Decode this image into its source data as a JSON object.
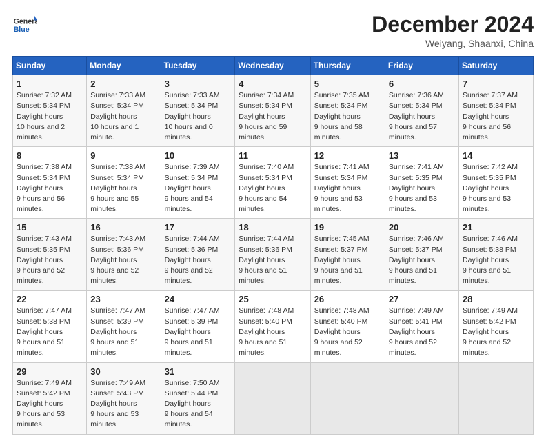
{
  "header": {
    "logo": {
      "general": "General",
      "blue": "Blue"
    },
    "title": "December 2024",
    "subtitle": "Weiyang, Shaanxi, China"
  },
  "weekdays": [
    "Sunday",
    "Monday",
    "Tuesday",
    "Wednesday",
    "Thursday",
    "Friday",
    "Saturday"
  ],
  "weeks": [
    [
      {
        "day": "1",
        "sunrise": "7:32 AM",
        "sunset": "5:34 PM",
        "daylight": "10 hours and 2 minutes."
      },
      {
        "day": "2",
        "sunrise": "7:33 AM",
        "sunset": "5:34 PM",
        "daylight": "10 hours and 1 minute."
      },
      {
        "day": "3",
        "sunrise": "7:33 AM",
        "sunset": "5:34 PM",
        "daylight": "10 hours and 0 minutes."
      },
      {
        "day": "4",
        "sunrise": "7:34 AM",
        "sunset": "5:34 PM",
        "daylight": "9 hours and 59 minutes."
      },
      {
        "day": "5",
        "sunrise": "7:35 AM",
        "sunset": "5:34 PM",
        "daylight": "9 hours and 58 minutes."
      },
      {
        "day": "6",
        "sunrise": "7:36 AM",
        "sunset": "5:34 PM",
        "daylight": "9 hours and 57 minutes."
      },
      {
        "day": "7",
        "sunrise": "7:37 AM",
        "sunset": "5:34 PM",
        "daylight": "9 hours and 56 minutes."
      }
    ],
    [
      {
        "day": "8",
        "sunrise": "7:38 AM",
        "sunset": "5:34 PM",
        "daylight": "9 hours and 56 minutes."
      },
      {
        "day": "9",
        "sunrise": "7:38 AM",
        "sunset": "5:34 PM",
        "daylight": "9 hours and 55 minutes."
      },
      {
        "day": "10",
        "sunrise": "7:39 AM",
        "sunset": "5:34 PM",
        "daylight": "9 hours and 54 minutes."
      },
      {
        "day": "11",
        "sunrise": "7:40 AM",
        "sunset": "5:34 PM",
        "daylight": "9 hours and 54 minutes."
      },
      {
        "day": "12",
        "sunrise": "7:41 AM",
        "sunset": "5:34 PM",
        "daylight": "9 hours and 53 minutes."
      },
      {
        "day": "13",
        "sunrise": "7:41 AM",
        "sunset": "5:35 PM",
        "daylight": "9 hours and 53 minutes."
      },
      {
        "day": "14",
        "sunrise": "7:42 AM",
        "sunset": "5:35 PM",
        "daylight": "9 hours and 53 minutes."
      }
    ],
    [
      {
        "day": "15",
        "sunrise": "7:43 AM",
        "sunset": "5:35 PM",
        "daylight": "9 hours and 52 minutes."
      },
      {
        "day": "16",
        "sunrise": "7:43 AM",
        "sunset": "5:36 PM",
        "daylight": "9 hours and 52 minutes."
      },
      {
        "day": "17",
        "sunrise": "7:44 AM",
        "sunset": "5:36 PM",
        "daylight": "9 hours and 52 minutes."
      },
      {
        "day": "18",
        "sunrise": "7:44 AM",
        "sunset": "5:36 PM",
        "daylight": "9 hours and 51 minutes."
      },
      {
        "day": "19",
        "sunrise": "7:45 AM",
        "sunset": "5:37 PM",
        "daylight": "9 hours and 51 minutes."
      },
      {
        "day": "20",
        "sunrise": "7:46 AM",
        "sunset": "5:37 PM",
        "daylight": "9 hours and 51 minutes."
      },
      {
        "day": "21",
        "sunrise": "7:46 AM",
        "sunset": "5:38 PM",
        "daylight": "9 hours and 51 minutes."
      }
    ],
    [
      {
        "day": "22",
        "sunrise": "7:47 AM",
        "sunset": "5:38 PM",
        "daylight": "9 hours and 51 minutes."
      },
      {
        "day": "23",
        "sunrise": "7:47 AM",
        "sunset": "5:39 PM",
        "daylight": "9 hours and 51 minutes."
      },
      {
        "day": "24",
        "sunrise": "7:47 AM",
        "sunset": "5:39 PM",
        "daylight": "9 hours and 51 minutes."
      },
      {
        "day": "25",
        "sunrise": "7:48 AM",
        "sunset": "5:40 PM",
        "daylight": "9 hours and 51 minutes."
      },
      {
        "day": "26",
        "sunrise": "7:48 AM",
        "sunset": "5:40 PM",
        "daylight": "9 hours and 52 minutes."
      },
      {
        "day": "27",
        "sunrise": "7:49 AM",
        "sunset": "5:41 PM",
        "daylight": "9 hours and 52 minutes."
      },
      {
        "day": "28",
        "sunrise": "7:49 AM",
        "sunset": "5:42 PM",
        "daylight": "9 hours and 52 minutes."
      }
    ],
    [
      {
        "day": "29",
        "sunrise": "7:49 AM",
        "sunset": "5:42 PM",
        "daylight": "9 hours and 53 minutes."
      },
      {
        "day": "30",
        "sunrise": "7:49 AM",
        "sunset": "5:43 PM",
        "daylight": "9 hours and 53 minutes."
      },
      {
        "day": "31",
        "sunrise": "7:50 AM",
        "sunset": "5:44 PM",
        "daylight": "9 hours and 54 minutes."
      },
      null,
      null,
      null,
      null
    ]
  ]
}
